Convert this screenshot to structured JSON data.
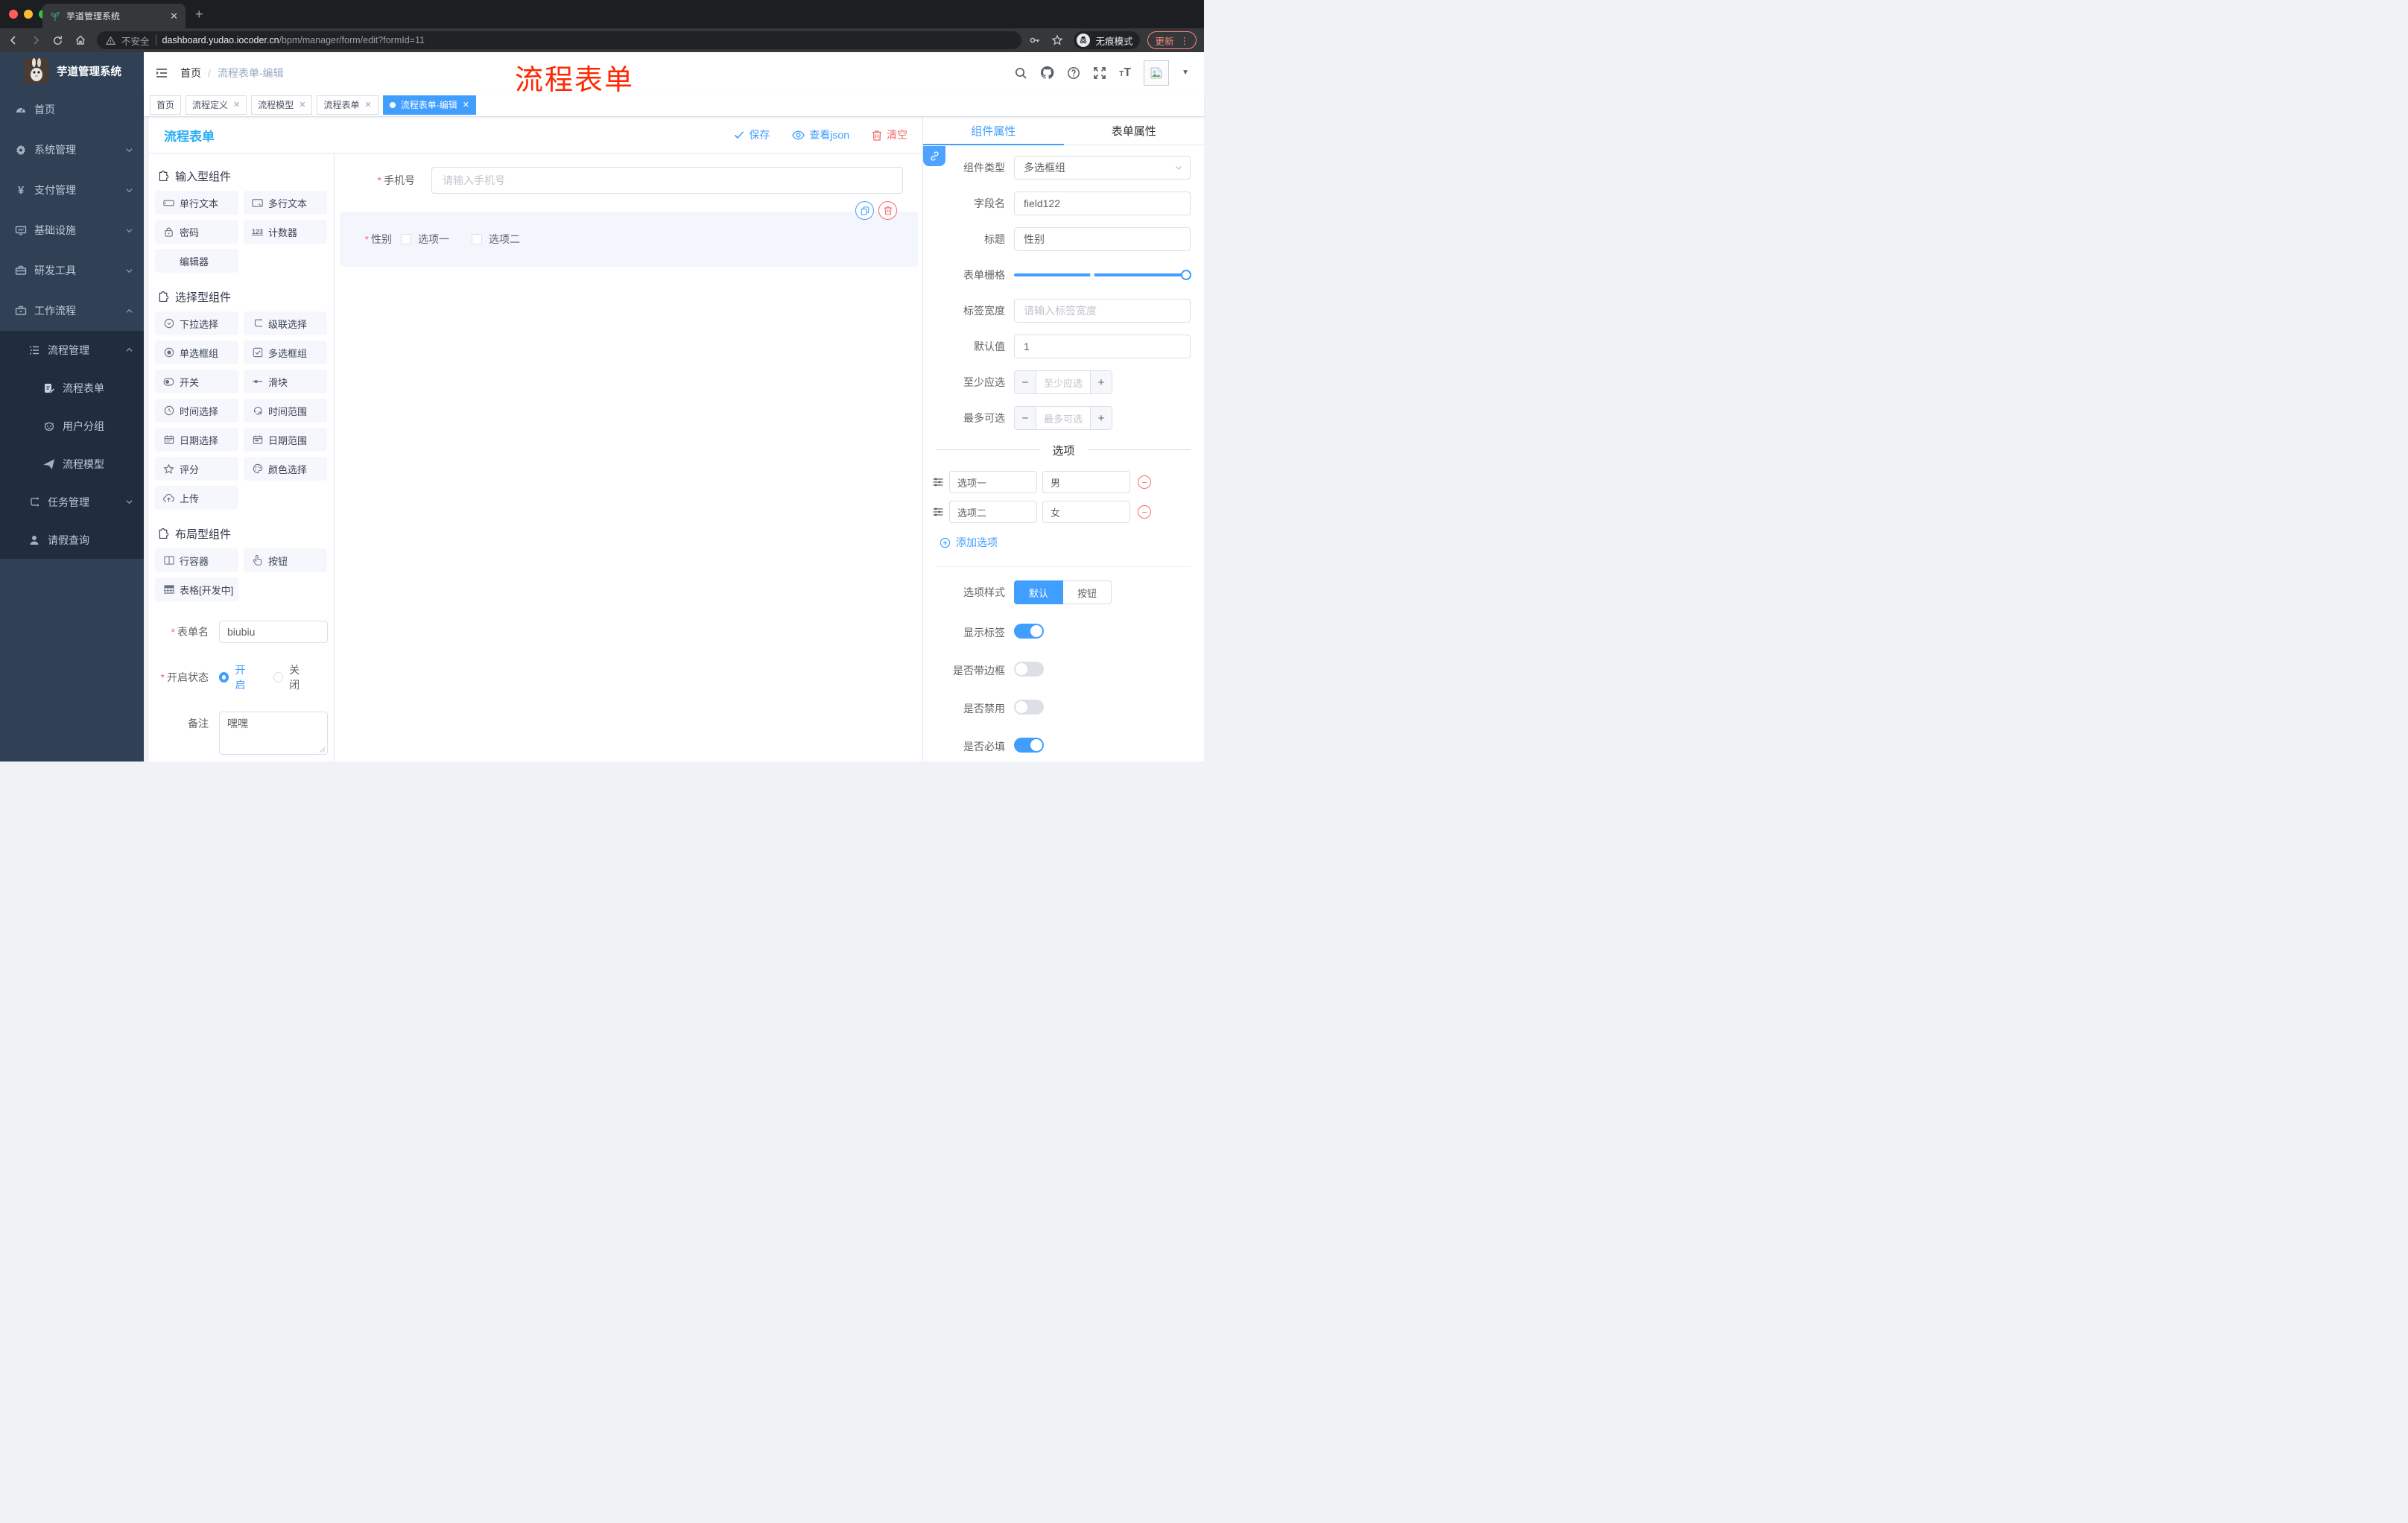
{
  "browser": {
    "tab_title": "芋道管理系统",
    "security_label": "不安全",
    "url_host": "dashboard.yudao.iocoder.cn",
    "url_path": "/bpm/manager/form/edit?formId=11",
    "incognito_label": "无痕模式",
    "update_label": "更新"
  },
  "sidebar": {
    "logo_title": "芋道管理系统",
    "items": [
      {
        "label": "首页"
      },
      {
        "label": "系统管理"
      },
      {
        "label": "支付管理"
      },
      {
        "label": "基础设施"
      },
      {
        "label": "研发工具"
      },
      {
        "label": "工作流程"
      },
      {
        "label": "流程管理"
      },
      {
        "label": "流程表单"
      },
      {
        "label": "用户分组"
      },
      {
        "label": "流程模型"
      },
      {
        "label": "任务管理"
      },
      {
        "label": "请假查询"
      }
    ]
  },
  "navbar": {
    "breadcrumb": [
      "首页",
      "流程表单-编辑"
    ],
    "annotation": "流程表单"
  },
  "tags": {
    "items": [
      {
        "label": "首页"
      },
      {
        "label": "流程定义"
      },
      {
        "label": "流程模型"
      },
      {
        "label": "流程表单"
      },
      {
        "label": "流程表单-编辑"
      }
    ]
  },
  "builder": {
    "title": "流程表单",
    "actions": {
      "save": "保存",
      "view_json": "查看json",
      "clear": "清空"
    },
    "sections": [
      {
        "title": "输入型组件",
        "items": [
          "单行文本",
          "多行文本",
          "密码",
          "计数器",
          "编辑器"
        ]
      },
      {
        "title": "选择型组件",
        "items": [
          "下拉选择",
          "级联选择",
          "单选框组",
          "多选框组",
          "开关",
          "滑块",
          "时间选择",
          "时间范围",
          "日期选择",
          "日期范围",
          "评分",
          "颜色选择",
          "上传"
        ]
      },
      {
        "title": "布局型组件",
        "items": [
          "行容器",
          "按钮",
          "表格[开发中]"
        ]
      }
    ],
    "form": {
      "name_label": "表单名",
      "name_value": "biubiu",
      "status_label": "开启状态",
      "status_on": "开启",
      "status_off": "关闭",
      "remark_label": "备注",
      "remark_value": "嘿嘿"
    },
    "canvas": {
      "phone_label": "手机号",
      "phone_placeholder": "请输入手机号",
      "gender_label": "性别",
      "gender_options": [
        "选项一",
        "选项二"
      ]
    }
  },
  "props": {
    "tabs": [
      "组件属性",
      "表单属性"
    ],
    "type_label": "组件类型",
    "type_value": "多选框组",
    "field_label": "字段名",
    "field_value": "field122",
    "title_label": "标题",
    "title_value": "性别",
    "grid_label": "表单栅格",
    "width_label": "标签宽度",
    "width_placeholder": "请输入标签宽度",
    "default_label": "默认值",
    "default_value": "1",
    "min_label": "至少应选",
    "min_placeholder": "至少应选",
    "max_label": "最多可选",
    "max_placeholder": "最多可选",
    "options_title": "选项",
    "options": [
      {
        "label": "选项一",
        "value": "男"
      },
      {
        "label": "选项二",
        "value": "女"
      }
    ],
    "add_option": "添加选项",
    "style_label": "选项样式",
    "style_default": "默认",
    "style_button": "按钮",
    "toggles": [
      {
        "label": "显示标签",
        "on": true
      },
      {
        "label": "是否带边框",
        "on": false
      },
      {
        "label": "是否禁用",
        "on": false
      },
      {
        "label": "是否必填",
        "on": true
      }
    ]
  },
  "colors": {
    "accent": "#409eff",
    "danger": "#f56c6c",
    "page_title_blue": "#2aaef5",
    "annotation_red": "#ff2600",
    "sidebar_bg": "#304156",
    "submenu_bg": "#1f2d3d",
    "chrome_update": "#f28b82",
    "selected_widget_bg": "#f4f6fe"
  }
}
